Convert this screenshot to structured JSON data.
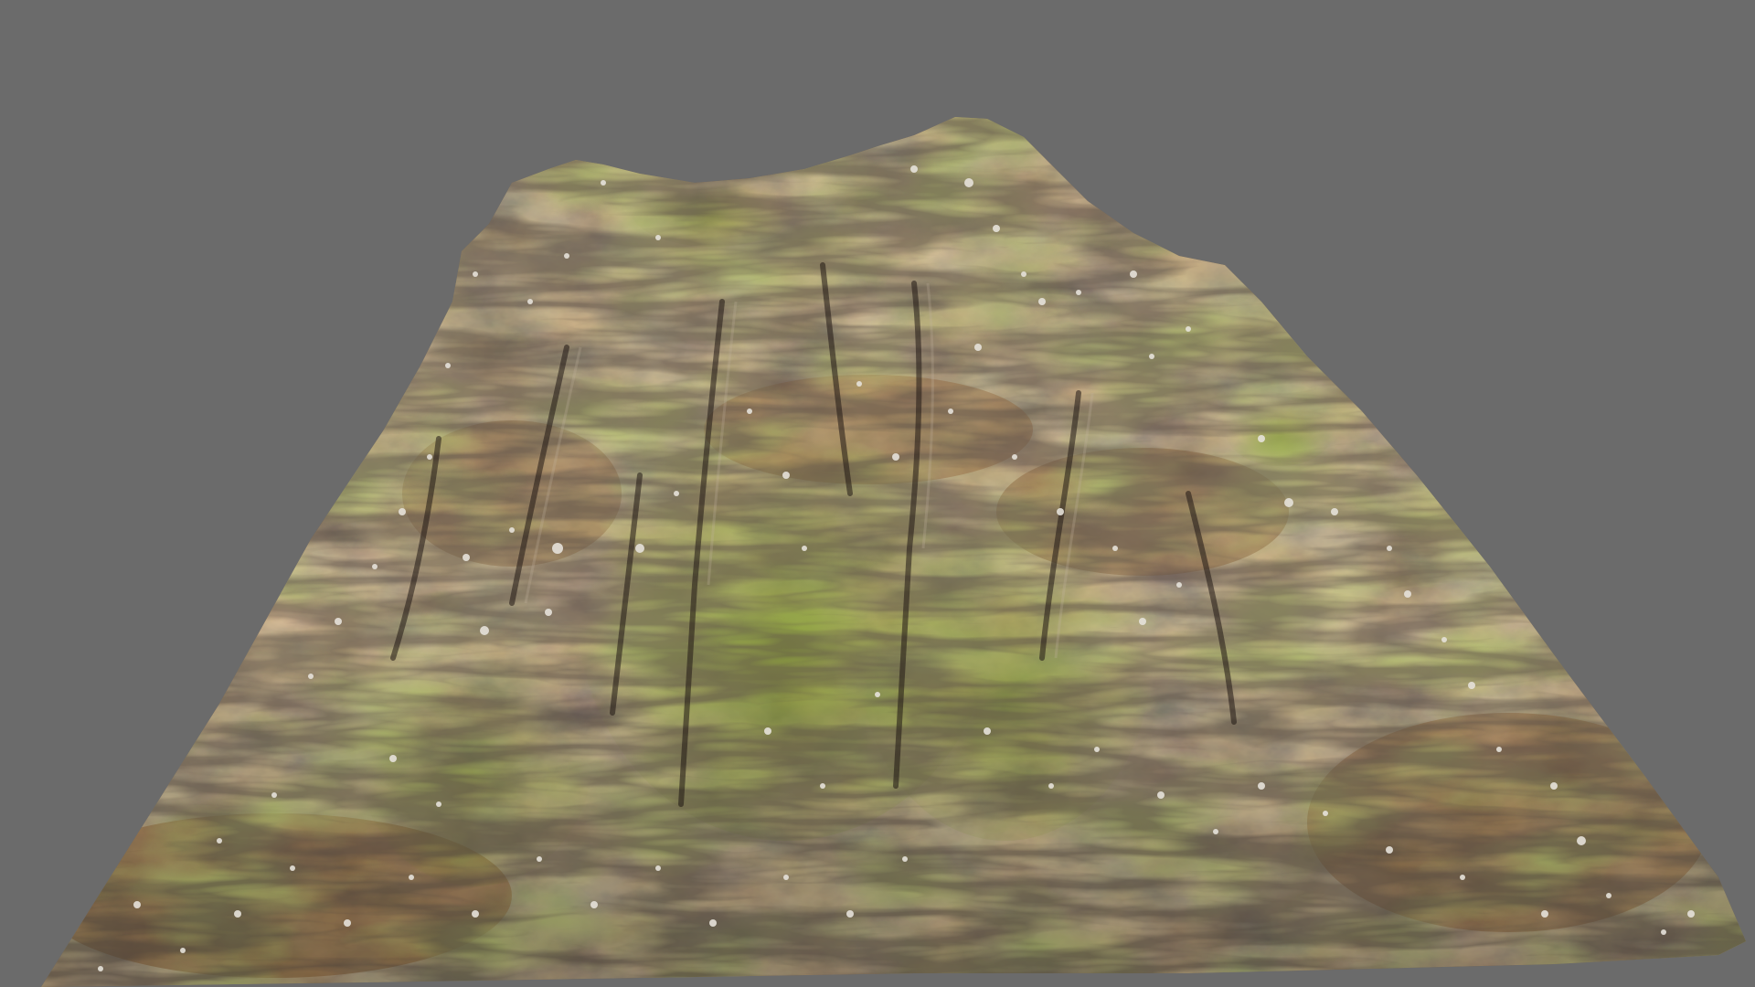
{
  "viewport": {
    "background_color": "#6b6b6b"
  },
  "model": {
    "subject": "rock-terrain-mound",
    "palette": {
      "rock_dark": "#3d322c",
      "rock_mid": "#5e4a3c",
      "rust_orange": "#8c5a2a",
      "moss_green": "#7a8f2c",
      "lichen_white": "#e6e2da"
    }
  }
}
